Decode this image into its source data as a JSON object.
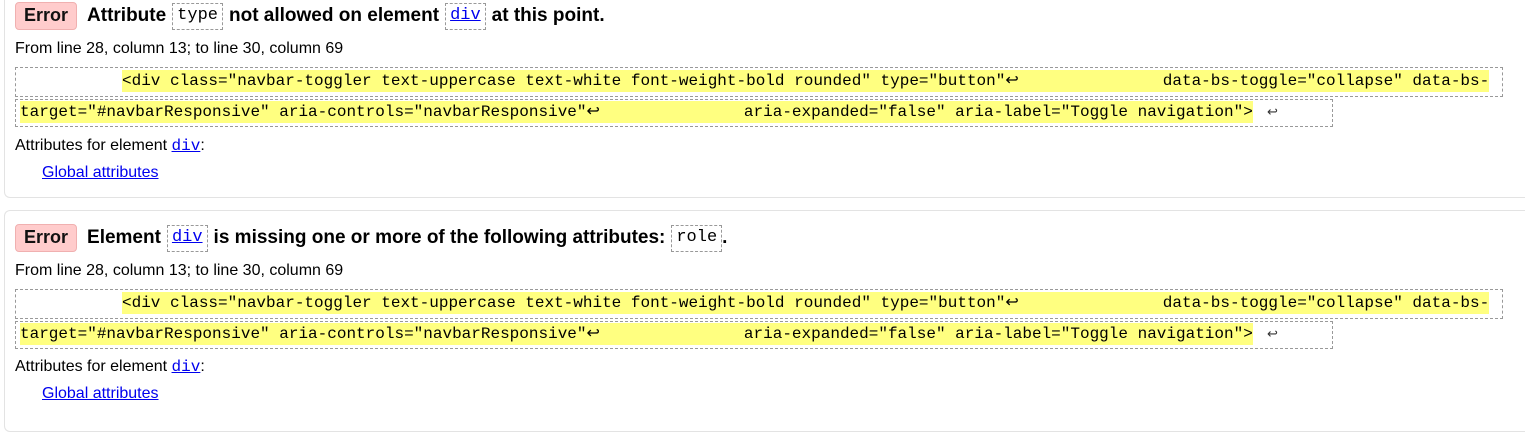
{
  "messages": [
    {
      "badge": "Error",
      "title_part1": "Attribute",
      "attr": "type",
      "title_part2": "not allowed on element",
      "element": "div",
      "title_part3": "at this point.",
      "location": "From line 28, column 13; to line 30, column 69",
      "code_line1": "<div class=\"navbar-toggler text-uppercase text-white font-weight-bold rounded\" type=\"button\"↩               data-bs-toggle=\"collapse\" data-bs-",
      "code_line2": "target=\"#navbarResponsive\" aria-controls=\"navbarResponsive\"↩               aria-expanded=\"false\" aria-label=\"Toggle navigation\">",
      "return_mark": "↩",
      "attrs_label": "Attributes for element",
      "attrs_element": "div",
      "attrs_colon": ":",
      "global_link": "Global attributes"
    },
    {
      "badge": "Error",
      "title_part1": "Element",
      "element": "div",
      "title_part2": "is missing one or more of the following attributes:",
      "attr": "role",
      "title_part3": ".",
      "location": "From line 28, column 13; to line 30, column 69",
      "code_line1": "<div class=\"navbar-toggler text-uppercase text-white font-weight-bold rounded\" type=\"button\"↩               data-bs-toggle=\"collapse\" data-bs-",
      "code_line2": "target=\"#navbarResponsive\" aria-controls=\"navbarResponsive\"↩               aria-expanded=\"false\" aria-label=\"Toggle navigation\">",
      "return_mark": "↩",
      "attrs_label": "Attributes for element",
      "attrs_element": "div",
      "attrs_colon": ":",
      "global_link": "Global attributes"
    }
  ],
  "colors": {
    "badge_bg": "#ffcccc",
    "highlight": "#ffff80",
    "link": "#0000ee"
  }
}
